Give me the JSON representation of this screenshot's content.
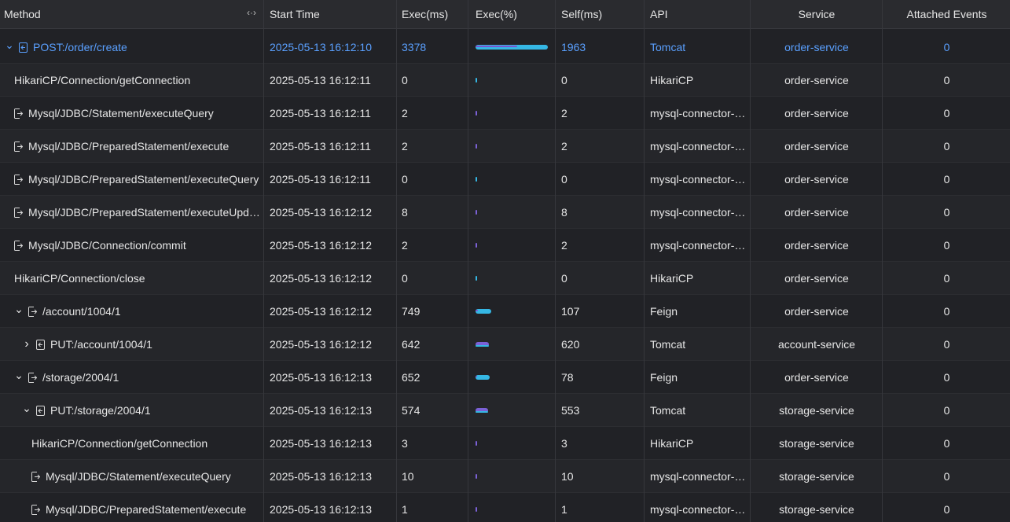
{
  "header": {
    "method": "Method",
    "resize_glyph": "‹·›",
    "start_time": "Start Time",
    "exec_ms": "Exec(ms)",
    "exec_pct": "Exec(%)",
    "self_ms": "Self(ms)",
    "api": "API",
    "service": "Service",
    "attached_events": "Attached Events"
  },
  "colors": {
    "highlight": "#5aa0ff",
    "bar_outer": "#35b7e4",
    "bar_inner": "#7a55d0",
    "bar_purple": "#7b61d6"
  },
  "rows": [
    {
      "method": "POST:/order/create",
      "indent": 0,
      "chevron": "down",
      "icon": "entry-icon",
      "start": "2025-05-13 16:12:10",
      "exec": "3378",
      "exec_pct": 1.0,
      "self_pct": 0.58,
      "self": "1963",
      "api": "Tomcat",
      "service": "order-service",
      "events": "0",
      "highlight": true
    },
    {
      "method": "HikariCP/Connection/getConnection",
      "indent": 1,
      "chevron": "",
      "icon": "",
      "start": "2025-05-13 16:12:11",
      "exec": "0",
      "exec_pct": 0.0,
      "self_pct": 0.0,
      "self": "0",
      "api": "HikariCP",
      "service": "order-service",
      "events": "0"
    },
    {
      "method": "Mysql/JDBC/Statement/executeQuery",
      "indent": 1,
      "chevron": "",
      "icon": "exit-icon",
      "start": "2025-05-13 16:12:11",
      "exec": "2",
      "exec_pct": 0.0006,
      "self_pct": 0.0006,
      "self": "2",
      "api": "mysql-connector-java",
      "service": "order-service",
      "events": "0"
    },
    {
      "method": "Mysql/JDBC/PreparedStatement/execute",
      "indent": 1,
      "chevron": "",
      "icon": "exit-icon",
      "start": "2025-05-13 16:12:11",
      "exec": "2",
      "exec_pct": 0.0006,
      "self_pct": 0.0006,
      "self": "2",
      "api": "mysql-connector-java",
      "service": "order-service",
      "events": "0"
    },
    {
      "method": "Mysql/JDBC/PreparedStatement/executeQuery",
      "indent": 1,
      "chevron": "",
      "icon": "exit-icon",
      "start": "2025-05-13 16:12:11",
      "exec": "0",
      "exec_pct": 0.0,
      "self_pct": 0.0,
      "self": "0",
      "api": "mysql-connector-java",
      "service": "order-service",
      "events": "0"
    },
    {
      "method": "Mysql/JDBC/PreparedStatement/executeUpdate",
      "indent": 1,
      "chevron": "",
      "icon": "exit-icon",
      "start": "2025-05-13 16:12:12",
      "exec": "8",
      "exec_pct": 0.0024,
      "self_pct": 0.0024,
      "self": "8",
      "api": "mysql-connector-java",
      "service": "order-service",
      "events": "0"
    },
    {
      "method": "Mysql/JDBC/Connection/commit",
      "indent": 1,
      "chevron": "",
      "icon": "exit-icon",
      "start": "2025-05-13 16:12:12",
      "exec": "2",
      "exec_pct": 0.0006,
      "self_pct": 0.0006,
      "self": "2",
      "api": "mysql-connector-java",
      "service": "order-service",
      "events": "0"
    },
    {
      "method": "HikariCP/Connection/close",
      "indent": 1,
      "chevron": "",
      "icon": "",
      "start": "2025-05-13 16:12:12",
      "exec": "0",
      "exec_pct": 0.0,
      "self_pct": 0.0,
      "self": "0",
      "api": "HikariCP",
      "service": "order-service",
      "events": "0"
    },
    {
      "method": "/account/1004/1",
      "indent": 1,
      "chevron": "down",
      "icon": "exit-icon",
      "start": "2025-05-13 16:12:12",
      "exec": "749",
      "exec_pct": 0.222,
      "self_pct": 0.032,
      "self": "107",
      "api": "Feign",
      "service": "order-service",
      "events": "0"
    },
    {
      "method": "PUT:/account/1004/1",
      "indent": 2,
      "chevron": "right",
      "icon": "entry-icon",
      "start": "2025-05-13 16:12:12",
      "exec": "642",
      "exec_pct": 0.19,
      "self_pct": 0.183,
      "self": "620",
      "api": "Tomcat",
      "service": "account-service",
      "events": "0"
    },
    {
      "method": "/storage/2004/1",
      "indent": 1,
      "chevron": "down",
      "icon": "exit-icon",
      "start": "2025-05-13 16:12:13",
      "exec": "652",
      "exec_pct": 0.193,
      "self_pct": 0.023,
      "self": "78",
      "api": "Feign",
      "service": "order-service",
      "events": "0"
    },
    {
      "method": "PUT:/storage/2004/1",
      "indent": 2,
      "chevron": "down",
      "icon": "entry-icon",
      "start": "2025-05-13 16:12:13",
      "exec": "574",
      "exec_pct": 0.17,
      "self_pct": 0.164,
      "self": "553",
      "api": "Tomcat",
      "service": "storage-service",
      "events": "0"
    },
    {
      "method": "HikariCP/Connection/getConnection",
      "indent": 3,
      "chevron": "",
      "icon": "",
      "start": "2025-05-13 16:12:13",
      "exec": "3",
      "exec_pct": 0.0009,
      "self_pct": 0.0009,
      "self": "3",
      "api": "HikariCP",
      "service": "storage-service",
      "events": "0"
    },
    {
      "method": "Mysql/JDBC/Statement/executeQuery",
      "indent": 3,
      "chevron": "",
      "icon": "exit-icon",
      "start": "2025-05-13 16:12:13",
      "exec": "10",
      "exec_pct": 0.003,
      "self_pct": 0.003,
      "self": "10",
      "api": "mysql-connector-java",
      "service": "storage-service",
      "events": "0"
    },
    {
      "method": "Mysql/JDBC/PreparedStatement/execute",
      "indent": 3,
      "chevron": "",
      "icon": "exit-icon",
      "start": "2025-05-13 16:12:13",
      "exec": "1",
      "exec_pct": 0.0003,
      "self_pct": 0.0003,
      "self": "1",
      "api": "mysql-connector-java",
      "service": "storage-service",
      "events": "0"
    }
  ]
}
